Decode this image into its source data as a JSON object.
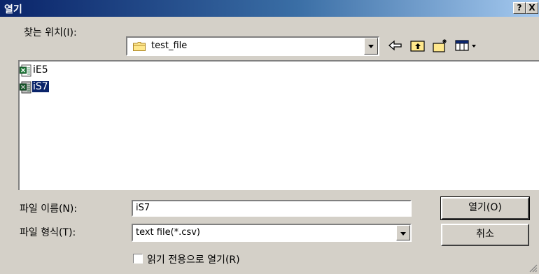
{
  "titlebar": {
    "title": "열기",
    "help_label": "?",
    "close_label": "X"
  },
  "look_in": {
    "label": "찾는 위치(I):",
    "value": "test_file",
    "icon": "folder-icon"
  },
  "toolbar": {
    "icons": [
      "back-arrow-icon",
      "up-folder-icon",
      "new-folder-icon",
      "view-menu-icon"
    ]
  },
  "files": [
    {
      "name": "iE5",
      "icon": "excel-file-icon",
      "selected": false
    },
    {
      "name": "iS7",
      "icon": "excel-file-icon",
      "selected": true
    }
  ],
  "filename": {
    "label": "파일 이름(N):",
    "value": "iS7"
  },
  "filetype": {
    "label": "파일 형식(T):",
    "value": "text file(*.csv)"
  },
  "buttons": {
    "open": "열기(O)",
    "cancel": "취소"
  },
  "readonly": {
    "label": "읽기 전용으로 열기(R)",
    "checked": false
  }
}
